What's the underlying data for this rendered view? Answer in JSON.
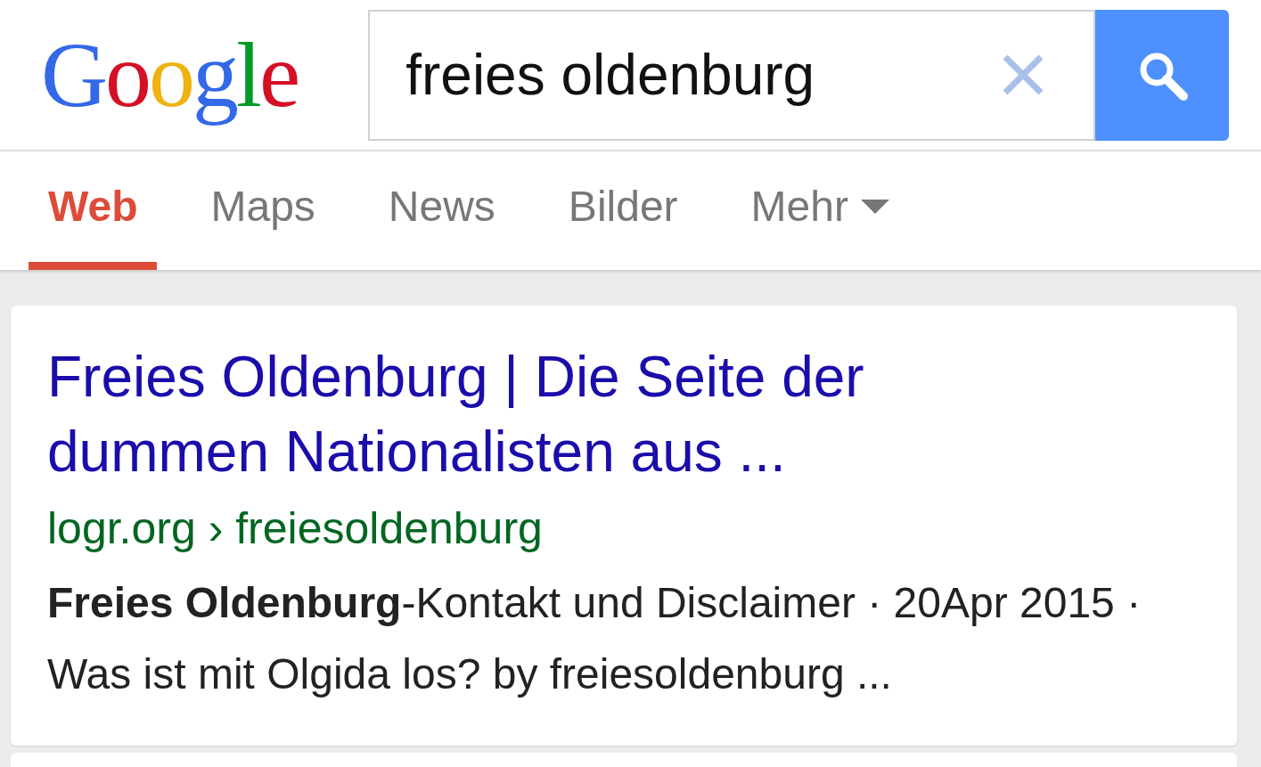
{
  "logo": "Google",
  "search": {
    "value": "freies oldenburg"
  },
  "tabs": [
    {
      "label": "Web",
      "selected": true,
      "dropdown": false
    },
    {
      "label": "Maps",
      "selected": false,
      "dropdown": false
    },
    {
      "label": "News",
      "selected": false,
      "dropdown": false
    },
    {
      "label": "Bilder",
      "selected": false,
      "dropdown": false
    },
    {
      "label": "Mehr",
      "selected": false,
      "dropdown": true
    }
  ],
  "results": [
    {
      "title": "Freies Oldenburg | Die Seite der dummen Nationalisten aus ...",
      "url": "logr.org › freiesoldenburg",
      "snippet": "**Freies Oldenburg**-Kontakt und Disclaimer · 20Apr 2015 · Was ist mit Olgida los? by freiesoldenburg ..."
    }
  ]
}
